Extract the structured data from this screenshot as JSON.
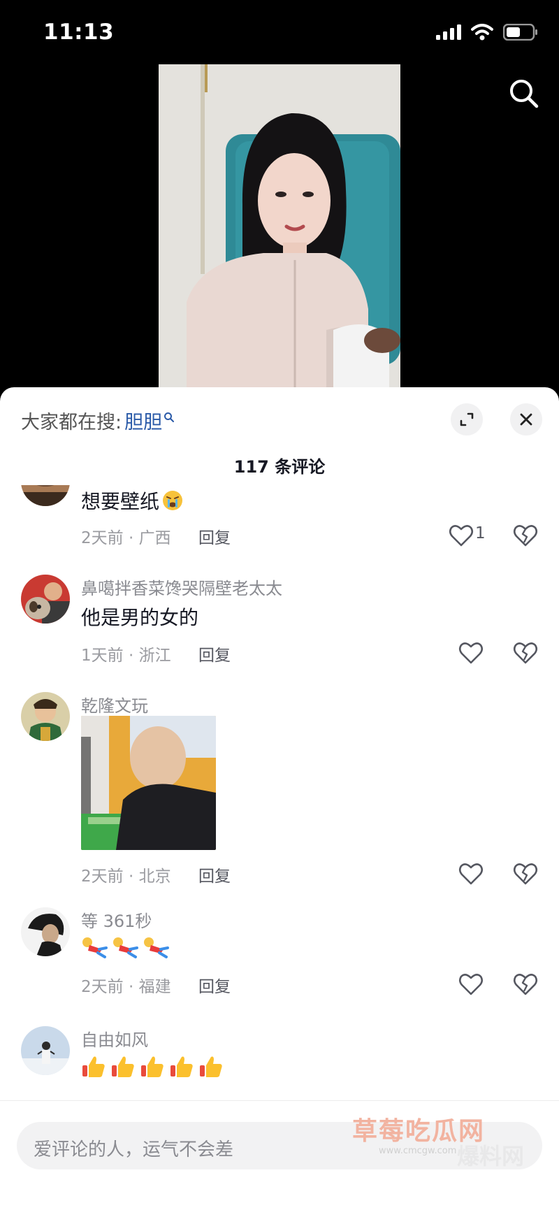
{
  "status_bar": {
    "time": "11:13"
  },
  "sheet": {
    "trending_prefix": "大家都在搜:",
    "trending_term": "胆胆",
    "comment_count": "117 条评论"
  },
  "comments": [
    {
      "username": "",
      "text": "想要壁纸",
      "time_location": "2天前 · 广西",
      "reply": "回复",
      "likes": "1"
    },
    {
      "username": "鼻噶拌香菜馋哭隔壁老太太",
      "text": "他是男的女的",
      "time_location": "1天前 · 浙江",
      "reply": "回复",
      "likes": ""
    },
    {
      "username": "乾隆文玩",
      "text": "",
      "time_location": "2天前 · 北京",
      "reply": "回复",
      "likes": ""
    },
    {
      "username": "等 361秒",
      "text": "",
      "time_location": "2天前 · 福建",
      "reply": "回复",
      "likes": ""
    },
    {
      "username": "自由如风",
      "text": "",
      "time_location": "",
      "reply": "",
      "likes": ""
    }
  ],
  "input": {
    "placeholder": "爱评论的人，运气不会差"
  },
  "watermark": {
    "line1": "草莓吃瓜网",
    "line2": "爆料网",
    "url": "www.cmcgw.com"
  },
  "icons": {
    "search": "search-icon",
    "expand": "expand-icon",
    "close": "close-icon",
    "like": "heart-outline-icon",
    "dislike": "broken-heart-icon"
  }
}
